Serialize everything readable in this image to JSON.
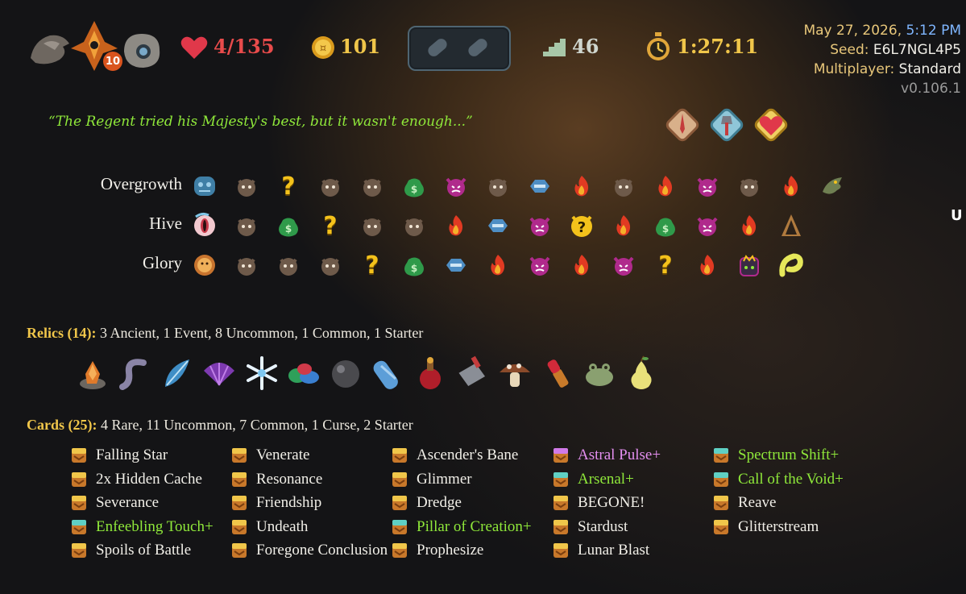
{
  "header": {
    "ascension_level": "10",
    "hp": "4/135",
    "gold": "101",
    "floor": "46",
    "run_time": "1:27:11",
    "potions": [
      "empty-potion-slot",
      "empty-potion-slot"
    ]
  },
  "run_info": {
    "date": "May 27, 2026,",
    "time": "5:12 PM",
    "seed_label": "Seed:",
    "seed": "E6L7NGL4P5",
    "multiplayer_label": "Multiplayer:",
    "multiplayer": "Standard",
    "version": "v0.106.1"
  },
  "quote": "“The Regent tried his Majesty's best, but it wasn't enough...”",
  "badges": [
    "sword-badge-icon",
    "axe-badge-icon",
    "heart-badge-icon"
  ],
  "map": {
    "acts": [
      {
        "name": "Overgrowth",
        "boss_icon": "overgrowth-icon",
        "nodes": [
          "monster",
          "unknown",
          "monster",
          "monster",
          "treasure",
          "elite",
          "monster",
          "shop",
          "rest",
          "monster",
          "rest",
          "elite",
          "monster",
          "rest",
          "boss-dragon"
        ]
      },
      {
        "name": "Hive",
        "boss_icon": "hive-icon",
        "nodes": [
          "monster",
          "treasure",
          "unknown",
          "monster",
          "monster",
          "rest",
          "shop",
          "elite",
          "unknown-monster",
          "rest",
          "treasure",
          "elite",
          "rest",
          "boss-hooded"
        ]
      },
      {
        "name": "Glory",
        "boss_icon": "glory-icon",
        "nodes": [
          "monster",
          "monster",
          "monster",
          "unknown",
          "treasure",
          "shop",
          "rest",
          "elite",
          "rest",
          "elite",
          "unknown",
          "rest",
          "boss-crown",
          "boss-serpent"
        ]
      }
    ]
  },
  "relics": {
    "title": "Relics (14):",
    "summary": "3 Ancient,  1 Event,  8 Uncommon,  1 Common,  1 Starter",
    "items": [
      "crystal-rock-icon",
      "gray-tentacle-icon",
      "blue-feather-icon",
      "purple-fan-icon",
      "snowflake-icon",
      "colored-stones-icon",
      "dark-orb-icon",
      "blue-sleeping-bag-icon",
      "red-potion-icon",
      "cleaver-icon",
      "mushroom-icon",
      "lipstick-icon",
      "frog-icon",
      "pear-icon"
    ]
  },
  "cards": {
    "title": "Cards (25):",
    "summary": "4 Rare,  11 Uncommon,  7 Common,  1 Curse,  2 Starter",
    "columns": [
      [
        {
          "name": "Falling Star",
          "color": "white"
        },
        {
          "name": "2x Hidden Cache",
          "color": "white"
        },
        {
          "name": "Severance",
          "color": "white"
        },
        {
          "name": "Enfeebling Touch+",
          "color": "green"
        },
        {
          "name": "Spoils of Battle",
          "color": "white"
        }
      ],
      [
        {
          "name": "Venerate",
          "color": "white"
        },
        {
          "name": "Resonance",
          "color": "white"
        },
        {
          "name": "Friendship",
          "color": "white"
        },
        {
          "name": "Undeath",
          "color": "white"
        },
        {
          "name": "Foregone Conclusion",
          "color": "white"
        }
      ],
      [
        {
          "name": "Ascender's Bane",
          "color": "white"
        },
        {
          "name": "Glimmer",
          "color": "white"
        },
        {
          "name": "Dredge",
          "color": "white"
        },
        {
          "name": "Pillar of Creation+",
          "color": "green"
        },
        {
          "name": "Prophesize",
          "color": "white"
        }
      ],
      [
        {
          "name": "Astral Pulse+",
          "color": "pink"
        },
        {
          "name": "Arsenal+",
          "color": "green"
        },
        {
          "name": "BEGONE!",
          "color": "white"
        },
        {
          "name": "Stardust",
          "color": "white"
        },
        {
          "name": "Lunar Blast",
          "color": "white"
        }
      ],
      [
        {
          "name": "Spectrum Shift+",
          "color": "green"
        },
        {
          "name": "Call of the Void+",
          "color": "green"
        },
        {
          "name": "Reave",
          "color": "white"
        },
        {
          "name": "Glitterstream",
          "color": "white"
        }
      ]
    ]
  },
  "side_mark": "U"
}
